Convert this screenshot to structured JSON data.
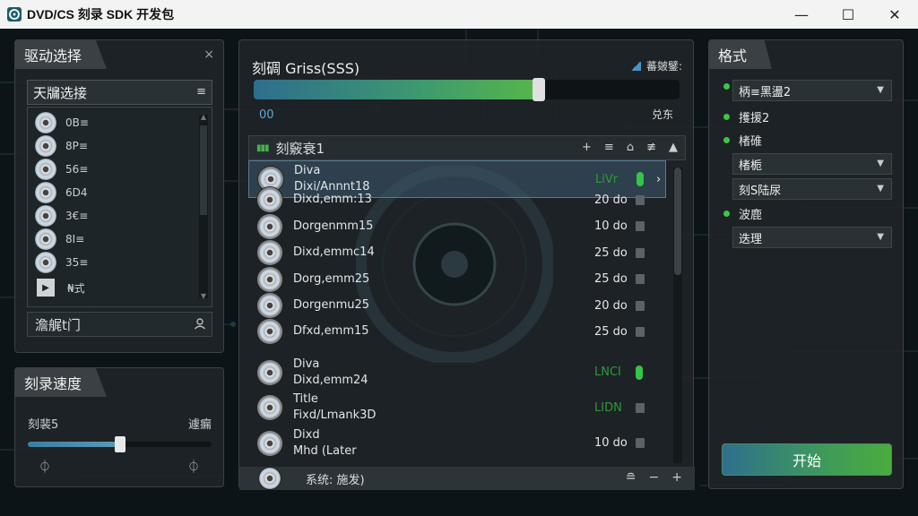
{
  "window": {
    "title": "DVD/CS 刻录 SDK 开发包",
    "minimize": "—",
    "maximize": "☐",
    "close": "✕"
  },
  "drive_panel": {
    "title": "驱动选择",
    "close": "×",
    "header": "天牖选接",
    "header_icon": "≡",
    "items": [
      {
        "label": "0B≡"
      },
      {
        "label": "8P≡"
      },
      {
        "label": "56≡"
      },
      {
        "label": "6D4"
      },
      {
        "label": "3€≡"
      },
      {
        "label": "8I≡"
      },
      {
        "label": "35≡"
      },
      {
        "label": "₦式"
      }
    ],
    "search_placeholder": "澹艉t门"
  },
  "speed_panel": {
    "title": "刻录速度",
    "left_label": "刻裴5",
    "right_label": "遽瘺",
    "slider_value": 0.5,
    "left_icon": "⏀",
    "right_icon": "⏀"
  },
  "burn_panel": {
    "title": "刻碉 Griss(SSS)",
    "badge": "蕃皴鐾:",
    "progress": 0.67,
    "progress_left": "00",
    "progress_right": "兑东",
    "list_title": "刻竅衰1",
    "list_tools": [
      "+",
      "≡",
      "⌂",
      "≢",
      "▲"
    ],
    "files": [
      {
        "name1": "Diva",
        "name2": "Dixi/Annnt18",
        "size": "LiVr",
        "size_green": true,
        "check_on": true,
        "selected": true
      },
      {
        "name1": "",
        "name2": "Dixd,emm:13",
        "size": "20 do",
        "size_green": false,
        "check_on": false,
        "selected": false
      },
      {
        "name1": "",
        "name2": "Dorgenmm15",
        "size": "10 do",
        "size_green": false,
        "check_on": false,
        "selected": false
      },
      {
        "name1": "",
        "name2": "Dixd,emmc14",
        "size": "25 do",
        "size_green": false,
        "check_on": false,
        "selected": false
      },
      {
        "name1": "",
        "name2": "Dorg,emm25",
        "size": "25 do",
        "size_green": false,
        "check_on": false,
        "selected": false
      },
      {
        "name1": "",
        "name2": "Dorgenmu25",
        "size": "20 do",
        "size_green": false,
        "check_on": false,
        "selected": false
      },
      {
        "name1": "",
        "name2": "Dfxd,emm15",
        "size": "25 do",
        "size_green": false,
        "check_on": false,
        "selected": false
      },
      {
        "name1": "Diva",
        "name2": "Dixd,emm24",
        "size": "LNCI",
        "size_green": true,
        "check_on": true,
        "selected": false
      },
      {
        "name1": "Title",
        "name2": "Fixd/Lmank3D",
        "size": "LIDN",
        "size_green": true,
        "check_on": false,
        "selected": false
      },
      {
        "name1": "Dixd",
        "name2": "Mhd (Later",
        "size": "10 do",
        "size_green": false,
        "check_on": false,
        "selected": false
      }
    ],
    "status_text": "系统: 施发)",
    "status_tools": [
      "≘",
      "−",
      "+"
    ]
  },
  "format_panel": {
    "title": "格式",
    "opt1_label": "柄≡黑盪2",
    "opt2_label": "擭援2",
    "opt3_label": "楮碓",
    "select1": "楮栀",
    "select2": "刻S陆尿",
    "opt4_label": "波鹿",
    "select3": "迭理",
    "caret": "▼",
    "start_label": "开始"
  },
  "colors": {
    "accent_green": "#3ec447",
    "accent_blue": "#2e6f8d"
  }
}
